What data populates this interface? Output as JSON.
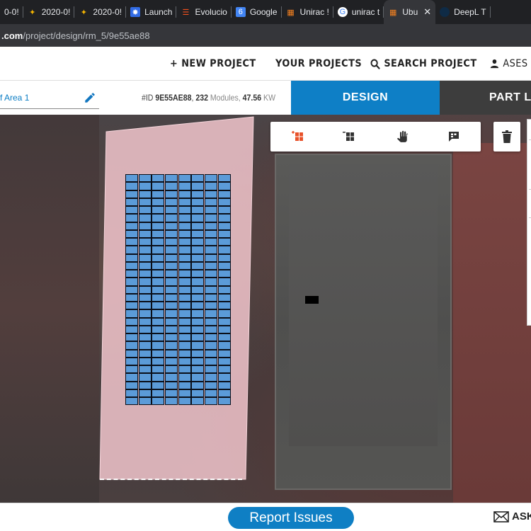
{
  "browser": {
    "tabs": [
      {
        "title": "0-0!",
        "icon": "generic"
      },
      {
        "title": "2020-0!",
        "icon": "pinwheel"
      },
      {
        "title": "2020-0!",
        "icon": "pinwheel"
      },
      {
        "title": "Launch",
        "icon": "kubernetes"
      },
      {
        "title": "Evolucio",
        "icon": "stack"
      },
      {
        "title": "Google",
        "icon": "calendar"
      },
      {
        "title": "Unirac !",
        "icon": "unirac"
      },
      {
        "title": "unirac t",
        "icon": "google"
      },
      {
        "title": "Ubu",
        "icon": "unirac",
        "active": true
      },
      {
        "title": "DeepL T",
        "icon": "deepl"
      }
    ],
    "url_host": ".com",
    "url_path": "/project/design/rm_5/9e55ae88"
  },
  "topnav": {
    "new_project": "+ NEW PROJECT",
    "your_projects": "YOUR PROJECTS",
    "search_project": "SEARCH PROJECT",
    "user": "ASES"
  },
  "subheader": {
    "area_name": "f Area 1",
    "id_prefix": "#ID ",
    "project_id": "9E55AE88",
    "module_count": "232",
    "modules_label": " Modules, ",
    "power": "47.56",
    "power_unit": " KW",
    "design_tab": "DESIGN",
    "part_list_tab": "PART LIS"
  },
  "map": {
    "panel_grid": {
      "columns": 8,
      "rows": 29,
      "panel_color": "#5b9bd8"
    },
    "roof_color": "#f2c5cd",
    "toolbar": [
      "add-module-icon",
      "remove-module-icon",
      "pan-hand-icon",
      "comment-icon"
    ],
    "accent_orange": "#e8522a"
  },
  "footer": {
    "report_issues": "Report Issues",
    "ask": "ASK"
  },
  "colors": {
    "brand_blue": "#0e7fc6",
    "dark_tab": "#3d3d3d"
  }
}
